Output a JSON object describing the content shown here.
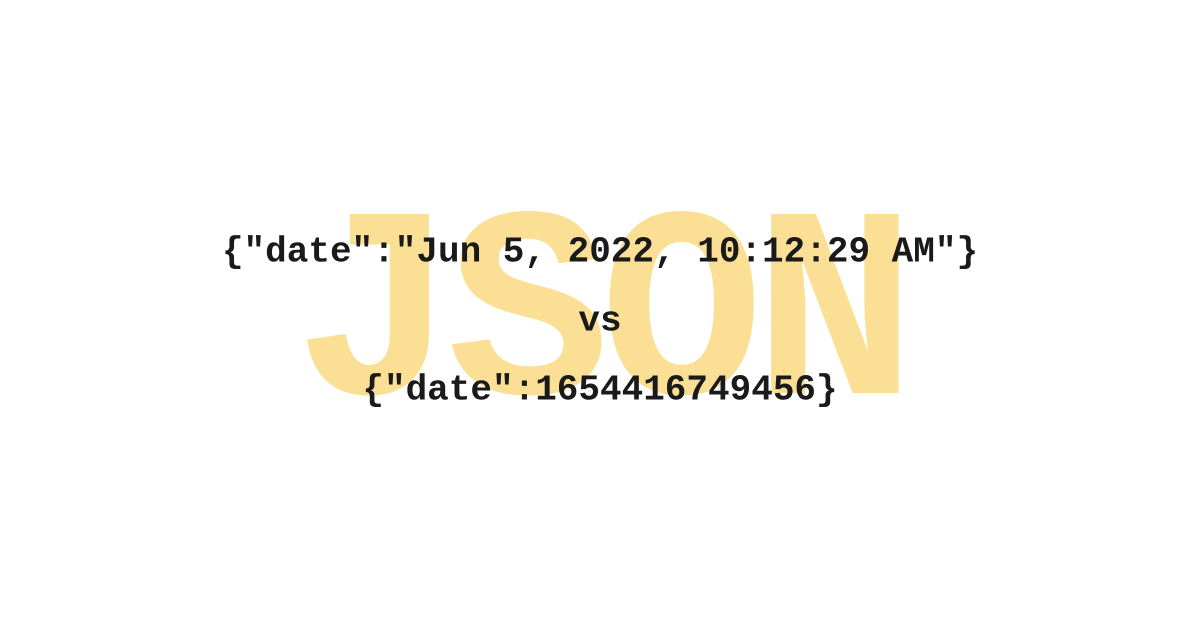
{
  "background": {
    "text": "JSON"
  },
  "comparison": {
    "line1": "{\"date\":\"Jun 5, 2022, 10:12:29 AM\"}",
    "separator": "vs",
    "line2": "{\"date\":1654416749456}"
  }
}
